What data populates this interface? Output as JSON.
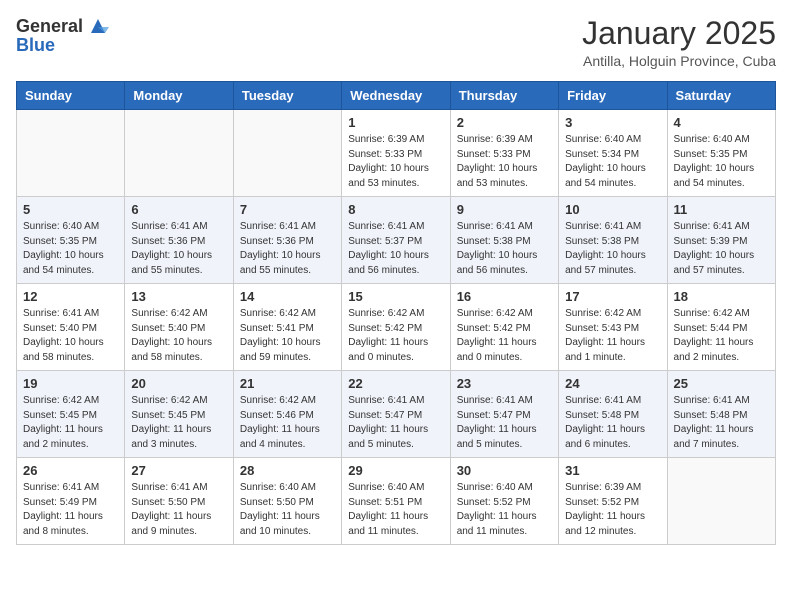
{
  "header": {
    "logo_general": "General",
    "logo_blue": "Blue",
    "month_title": "January 2025",
    "location": "Antilla, Holguin Province, Cuba"
  },
  "days_of_week": [
    "Sunday",
    "Monday",
    "Tuesday",
    "Wednesday",
    "Thursday",
    "Friday",
    "Saturday"
  ],
  "weeks": [
    [
      {
        "day": "",
        "info": ""
      },
      {
        "day": "",
        "info": ""
      },
      {
        "day": "",
        "info": ""
      },
      {
        "day": "1",
        "info": "Sunrise: 6:39 AM\nSunset: 5:33 PM\nDaylight: 10 hours\nand 53 minutes."
      },
      {
        "day": "2",
        "info": "Sunrise: 6:39 AM\nSunset: 5:33 PM\nDaylight: 10 hours\nand 53 minutes."
      },
      {
        "day": "3",
        "info": "Sunrise: 6:40 AM\nSunset: 5:34 PM\nDaylight: 10 hours\nand 54 minutes."
      },
      {
        "day": "4",
        "info": "Sunrise: 6:40 AM\nSunset: 5:35 PM\nDaylight: 10 hours\nand 54 minutes."
      }
    ],
    [
      {
        "day": "5",
        "info": "Sunrise: 6:40 AM\nSunset: 5:35 PM\nDaylight: 10 hours\nand 54 minutes."
      },
      {
        "day": "6",
        "info": "Sunrise: 6:41 AM\nSunset: 5:36 PM\nDaylight: 10 hours\nand 55 minutes."
      },
      {
        "day": "7",
        "info": "Sunrise: 6:41 AM\nSunset: 5:36 PM\nDaylight: 10 hours\nand 55 minutes."
      },
      {
        "day": "8",
        "info": "Sunrise: 6:41 AM\nSunset: 5:37 PM\nDaylight: 10 hours\nand 56 minutes."
      },
      {
        "day": "9",
        "info": "Sunrise: 6:41 AM\nSunset: 5:38 PM\nDaylight: 10 hours\nand 56 minutes."
      },
      {
        "day": "10",
        "info": "Sunrise: 6:41 AM\nSunset: 5:38 PM\nDaylight: 10 hours\nand 57 minutes."
      },
      {
        "day": "11",
        "info": "Sunrise: 6:41 AM\nSunset: 5:39 PM\nDaylight: 10 hours\nand 57 minutes."
      }
    ],
    [
      {
        "day": "12",
        "info": "Sunrise: 6:41 AM\nSunset: 5:40 PM\nDaylight: 10 hours\nand 58 minutes."
      },
      {
        "day": "13",
        "info": "Sunrise: 6:42 AM\nSunset: 5:40 PM\nDaylight: 10 hours\nand 58 minutes."
      },
      {
        "day": "14",
        "info": "Sunrise: 6:42 AM\nSunset: 5:41 PM\nDaylight: 10 hours\nand 59 minutes."
      },
      {
        "day": "15",
        "info": "Sunrise: 6:42 AM\nSunset: 5:42 PM\nDaylight: 11 hours\nand 0 minutes."
      },
      {
        "day": "16",
        "info": "Sunrise: 6:42 AM\nSunset: 5:42 PM\nDaylight: 11 hours\nand 0 minutes."
      },
      {
        "day": "17",
        "info": "Sunrise: 6:42 AM\nSunset: 5:43 PM\nDaylight: 11 hours\nand 1 minute."
      },
      {
        "day": "18",
        "info": "Sunrise: 6:42 AM\nSunset: 5:44 PM\nDaylight: 11 hours\nand 2 minutes."
      }
    ],
    [
      {
        "day": "19",
        "info": "Sunrise: 6:42 AM\nSunset: 5:45 PM\nDaylight: 11 hours\nand 2 minutes."
      },
      {
        "day": "20",
        "info": "Sunrise: 6:42 AM\nSunset: 5:45 PM\nDaylight: 11 hours\nand 3 minutes."
      },
      {
        "day": "21",
        "info": "Sunrise: 6:42 AM\nSunset: 5:46 PM\nDaylight: 11 hours\nand 4 minutes."
      },
      {
        "day": "22",
        "info": "Sunrise: 6:41 AM\nSunset: 5:47 PM\nDaylight: 11 hours\nand 5 minutes."
      },
      {
        "day": "23",
        "info": "Sunrise: 6:41 AM\nSunset: 5:47 PM\nDaylight: 11 hours\nand 5 minutes."
      },
      {
        "day": "24",
        "info": "Sunrise: 6:41 AM\nSunset: 5:48 PM\nDaylight: 11 hours\nand 6 minutes."
      },
      {
        "day": "25",
        "info": "Sunrise: 6:41 AM\nSunset: 5:48 PM\nDaylight: 11 hours\nand 7 minutes."
      }
    ],
    [
      {
        "day": "26",
        "info": "Sunrise: 6:41 AM\nSunset: 5:49 PM\nDaylight: 11 hours\nand 8 minutes."
      },
      {
        "day": "27",
        "info": "Sunrise: 6:41 AM\nSunset: 5:50 PM\nDaylight: 11 hours\nand 9 minutes."
      },
      {
        "day": "28",
        "info": "Sunrise: 6:40 AM\nSunset: 5:50 PM\nDaylight: 11 hours\nand 10 minutes."
      },
      {
        "day": "29",
        "info": "Sunrise: 6:40 AM\nSunset: 5:51 PM\nDaylight: 11 hours\nand 11 minutes."
      },
      {
        "day": "30",
        "info": "Sunrise: 6:40 AM\nSunset: 5:52 PM\nDaylight: 11 hours\nand 11 minutes."
      },
      {
        "day": "31",
        "info": "Sunrise: 6:39 AM\nSunset: 5:52 PM\nDaylight: 11 hours\nand 12 minutes."
      },
      {
        "day": "",
        "info": ""
      }
    ]
  ]
}
